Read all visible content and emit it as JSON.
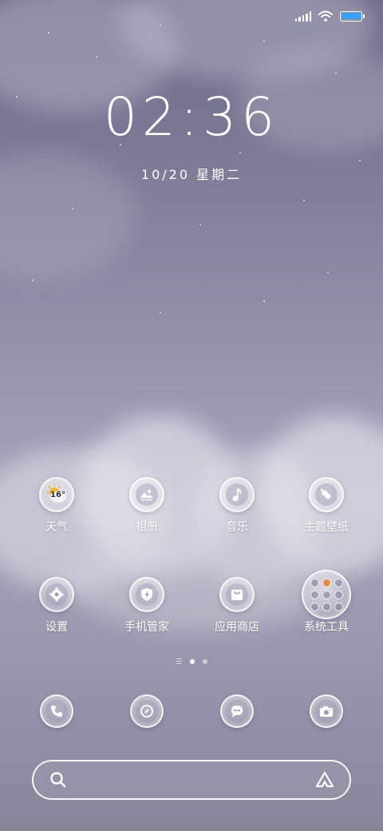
{
  "status_bar": {
    "signal_icon": "cellular-signal-icon",
    "wifi_icon": "wifi-icon",
    "battery_icon": "battery-icon",
    "battery_color": "#3aa0ff"
  },
  "lockscreen": {
    "time": "02:36",
    "date": "10/20  星期二"
  },
  "apps": [
    {
      "label": "天气",
      "icon": "weather-icon",
      "temp": "16°"
    },
    {
      "label": "相册",
      "icon": "gallery-icon"
    },
    {
      "label": "音乐",
      "icon": "music-note-icon"
    },
    {
      "label": "主题壁纸",
      "icon": "theme-brush-icon"
    },
    {
      "label": "设置",
      "icon": "gear-icon"
    },
    {
      "label": "手机管家",
      "icon": "shield-icon"
    },
    {
      "label": "应用商店",
      "icon": "shopping-bag-icon"
    },
    {
      "label": "系统工具",
      "icon": "folder-icon"
    }
  ],
  "page_indicator": {
    "pages": 2,
    "active": 1
  },
  "dock": [
    {
      "icon": "phone-icon"
    },
    {
      "icon": "compass-icon"
    },
    {
      "icon": "message-icon"
    },
    {
      "icon": "camera-icon"
    }
  ],
  "search": {
    "search_icon": "search-icon",
    "assistant_icon": "assistant-icon"
  }
}
